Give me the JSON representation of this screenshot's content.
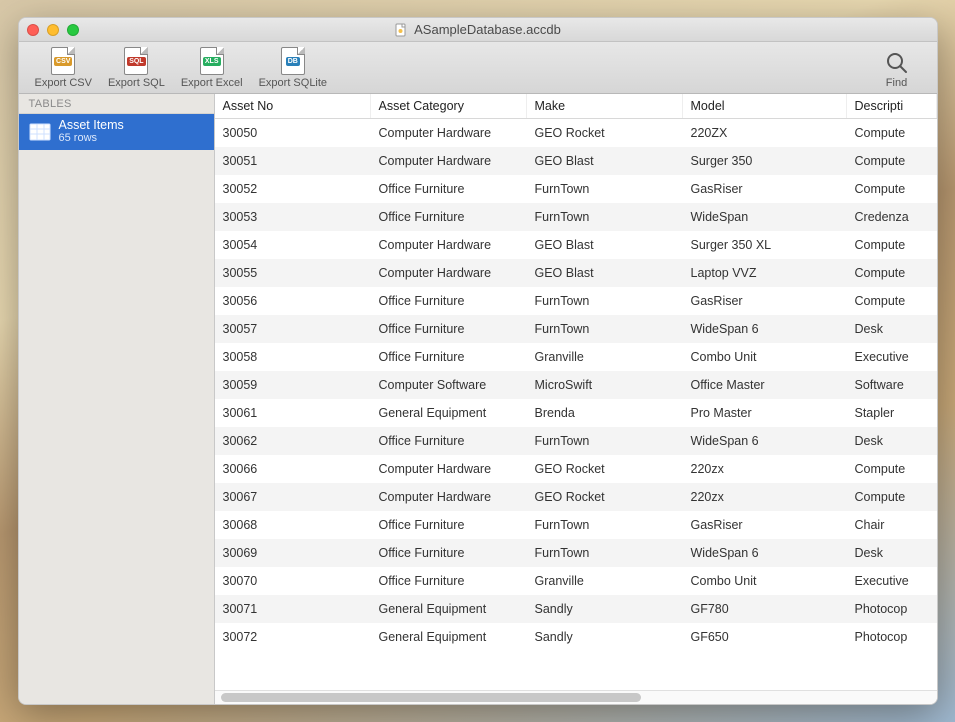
{
  "window": {
    "title": "ASampleDatabase.accdb"
  },
  "toolbar": {
    "export_csv": "Export CSV",
    "export_sql": "Export SQL",
    "export_excel": "Export Excel",
    "export_sqlite": "Export SQLite",
    "find": "Find"
  },
  "sidebar": {
    "header": "TABLES",
    "items": [
      {
        "name": "Asset Items",
        "sub": "65 rows"
      }
    ]
  },
  "table": {
    "columns": [
      "Asset No",
      "Asset Category",
      "Make",
      "Model",
      "Descripti"
    ],
    "rows": [
      [
        "30050",
        "Computer Hardware",
        "GEO Rocket",
        "220ZX",
        "Compute"
      ],
      [
        "30051",
        "Computer Hardware",
        "GEO Blast",
        "Surger 350",
        "Compute"
      ],
      [
        "30052",
        "Office Furniture",
        "FurnTown",
        "GasRiser",
        "Compute"
      ],
      [
        "30053",
        "Office Furniture",
        "FurnTown",
        "WideSpan",
        "Credenza"
      ],
      [
        "30054",
        "Computer Hardware",
        "GEO Blast",
        "Surger 350 XL",
        "Compute"
      ],
      [
        "30055",
        "Computer Hardware",
        "GEO Blast",
        "Laptop VVZ",
        "Compute"
      ],
      [
        "30056",
        "Office Furniture",
        "FurnTown",
        "GasRiser",
        "Compute"
      ],
      [
        "30057",
        "Office Furniture",
        "FurnTown",
        "WideSpan 6",
        "Desk"
      ],
      [
        "30058",
        "Office Furniture",
        "Granville",
        "Combo Unit",
        "Executive"
      ],
      [
        "30059",
        "Computer Software",
        "MicroSwift",
        "Office Master",
        "Software"
      ],
      [
        "30061",
        "General Equipment",
        "Brenda",
        "Pro Master",
        "Stapler"
      ],
      [
        "30062",
        "Office Furniture",
        "FurnTown",
        "WideSpan 6",
        "Desk"
      ],
      [
        "30066",
        "Computer Hardware",
        "GEO Rocket",
        "220zx",
        "Compute"
      ],
      [
        "30067",
        "Computer Hardware",
        "GEO Rocket",
        "220zx",
        "Compute"
      ],
      [
        "30068",
        "Office Furniture",
        "FurnTown",
        "GasRiser",
        "Chair"
      ],
      [
        "30069",
        "Office Furniture",
        "FurnTown",
        "WideSpan 6",
        "Desk"
      ],
      [
        "30070",
        "Office Furniture",
        "Granville",
        "Combo Unit",
        "Executive"
      ],
      [
        "30071",
        "General Equipment",
        "Sandly",
        "GF780",
        "Photocop"
      ],
      [
        "30072",
        "General Equipment",
        "Sandly",
        "GF650",
        "Photocop"
      ]
    ]
  }
}
